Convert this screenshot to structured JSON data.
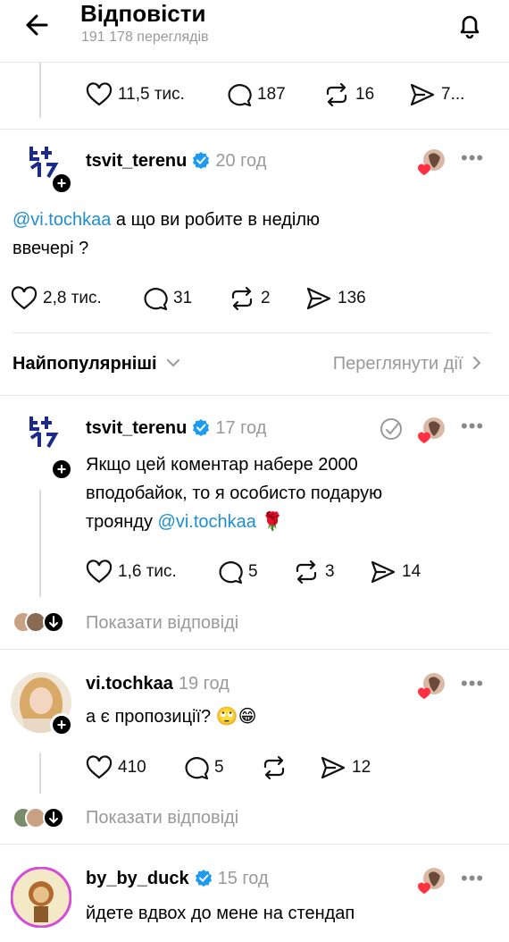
{
  "header": {
    "title": "Відповісти",
    "views": "191 178 переглядів"
  },
  "top_actions": {
    "likes": "11,5 тис.",
    "comments": "187",
    "reposts": "16",
    "shares": "7..."
  },
  "post1": {
    "username": "tsvit_terenu",
    "time": "20 год",
    "mention": "@vi.tochkaa",
    "text_line1": " а що ви робите в неділю",
    "text_line2": "ввечері ?",
    "likes": "2,8 тис.",
    "comments": "31",
    "reposts": "2",
    "shares": "136"
  },
  "sort": {
    "label": "Найпопулярніші",
    "activity": "Переглянути дії"
  },
  "post2": {
    "username": "tsvit_terenu",
    "time": "17 год",
    "text_line1": "Якщо цей коментар набере 2000",
    "text_line2": "вподобайок, то я особисто подарую",
    "text_line3_prefix": "троянду ",
    "mention": "@vi.tochkaa",
    "emoji": "🌹",
    "likes": "1,6 тис.",
    "comments": "5",
    "reposts": "3",
    "shares": "14",
    "show_replies": "Показати відповіді"
  },
  "post3": {
    "username": "vi.tochkaa",
    "time": "19 год",
    "text": "а є пропозиції? 🙄😁",
    "likes": "410",
    "comments": "5",
    "reposts": "",
    "shares": "12",
    "show_replies": "Показати відповіді"
  },
  "post4": {
    "username": "by_by_duck",
    "time": "15 год",
    "text": "йдете вдвох до мене на стендап"
  },
  "colors": {
    "mention": "#1d8fd1",
    "verified": "#1d9bf0",
    "heart": "#ff3040",
    "muted": "#999999"
  },
  "icons": [
    "back-arrow-icon",
    "bell-icon",
    "heart-icon",
    "comment-icon",
    "repost-icon",
    "share-icon",
    "verified-icon",
    "more-icon",
    "chevron-down-icon",
    "chevron-right-icon",
    "plus-icon"
  ]
}
